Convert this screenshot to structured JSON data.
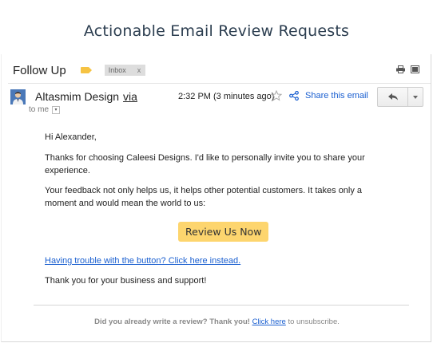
{
  "page": {
    "title": "Actionable Email Review Requests"
  },
  "email": {
    "subject": "Follow Up",
    "label_chip": {
      "text": "Inbox",
      "remove": "x"
    },
    "sender": {
      "name": "Altasmim Design",
      "via": "via"
    },
    "recipient": "to me",
    "timestamp": "2:32 PM (3 minutes ago)",
    "share_label": "Share this email",
    "body": {
      "greeting": "Hi Alexander,",
      "paragraph_1": "Thanks for choosing Caleesi Designs. I'd like to personally invite you to share your experience.",
      "paragraph_2": "Your feedback not only helps us, it helps other potential customers. It takes only a moment and would mean the world to us:",
      "cta_label": "Review Us Now",
      "fallback_link": "Having trouble with the button? Click here instead.",
      "closing": "Thank you for your business and support!"
    },
    "footer": {
      "prefix": "Did you already write a review? Thank you!",
      "link": "Click here",
      "suffix": "to unsubscribe."
    }
  },
  "colors": {
    "cta_background": "#fdd56e",
    "link": "#1a5fd0",
    "label_tag": "#f6c343"
  },
  "icons": [
    "label-tag-icon",
    "print-icon",
    "popout-icon",
    "star-icon",
    "share-icon",
    "reply-icon",
    "more-caret-icon"
  ]
}
